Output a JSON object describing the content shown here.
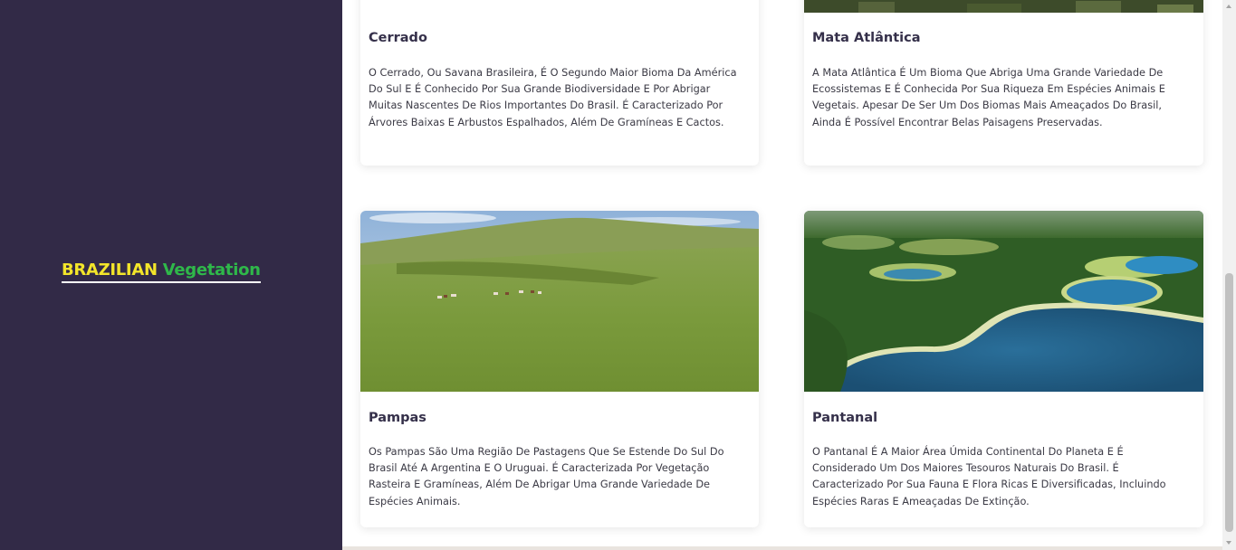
{
  "brand": {
    "word1": "BRAZILIAN",
    "word2": "Vegetation"
  },
  "cards": [
    {
      "title": "Cerrado",
      "description": "O Cerrado, Ou Savana Brasileira, É O Segundo Maior Bioma Da América Do Sul E É Conhecido Por Sua Grande Biodiversidade E Por Abrigar Muitas Nascentes De Rios Importantes Do Brasil. É Caracterizado Por Árvores Baixas E Arbustos Espalhados, Além De Gramíneas E Cactos."
    },
    {
      "title": "Mata Atlântica",
      "description": "A Mata Atlântica É Um Bioma Que Abriga Uma Grande Variedade De Ecossistemas E É Conhecida Por Sua Riqueza Em Espécies Animais E Vegetais. Apesar De Ser Um Dos Biomas Mais Ameaçados Do Brasil, Ainda É Possível Encontrar Belas Paisagens Preservadas."
    },
    {
      "title": "Pampas",
      "description": "Os Pampas São Uma Região De Pastagens Que Se Estende Do Sul Do Brasil Até A Argentina E O Uruguai. É Caracterizada Por Vegetação Rasteira E Gramíneas, Além De Abrigar Uma Grande Variedade De Espécies Animais."
    },
    {
      "title": "Pantanal",
      "description": "O Pantanal É A Maior Área Úmida Continental Do Planeta E É Considerado Um Dos Maiores Tesouros Naturais Do Brasil. É Caracterizado Por Sua Fauna E Flora Ricas E Diversificadas, Incluindo Espécies Raras E Ameaçadas De Extinção."
    }
  ],
  "colors": {
    "sidebar": "#322a47",
    "brand_yellow": "#f3e52a",
    "brand_green": "#2fb84a",
    "title": "#35304a"
  }
}
